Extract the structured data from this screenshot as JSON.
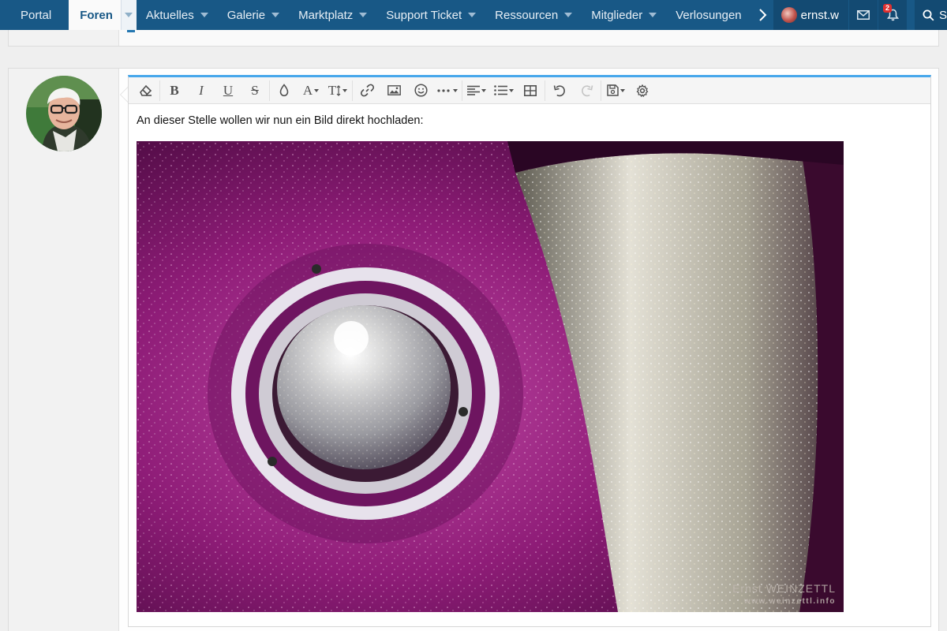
{
  "nav": {
    "tabs": [
      {
        "label": "Portal"
      },
      {
        "label": "Foren"
      },
      {
        "label": "Aktuelles"
      },
      {
        "label": "Galerie"
      },
      {
        "label": "Marktplatz"
      },
      {
        "label": "Support Ticket"
      },
      {
        "label": "Ressourcen"
      },
      {
        "label": "Mitglieder"
      },
      {
        "label": "Verlosungen"
      }
    ],
    "active_tab": "Foren",
    "user": {
      "name": "ernst.w"
    },
    "notifications_badge": "2",
    "search_label": "Suche"
  },
  "editor": {
    "toolbar": {
      "groups": [
        [
          "remove-format-icon"
        ],
        [
          "bold",
          "italic",
          "underline",
          "strikethrough"
        ],
        [
          "text-color-icon",
          "font-family",
          "font-size"
        ],
        [
          "link-icon",
          "image-icon",
          "smilie-icon",
          "more-icon"
        ],
        [
          "align-icon",
          "list-icon",
          "table-icon"
        ],
        [
          "undo-icon",
          "redo-icon"
        ],
        [
          "drafts-icon",
          "settings-icon"
        ]
      ],
      "bold_glyph": "B",
      "italic_glyph": "I",
      "underline_glyph": "U",
      "strike_glyph": "S",
      "font_glyph": "A",
      "size_glyph": "T"
    },
    "text": "An dieser Stelle wollen wir nun ein Bild direkt hochladen:",
    "image_watermark": {
      "line1": "Ernst WEINZETTL",
      "line2": "www.weinzettl.info"
    }
  },
  "colors": {
    "nav_bg": "#185886",
    "nav_dark": "#134a72",
    "editor_accent": "#47a7eb",
    "badge": "#e03030"
  }
}
